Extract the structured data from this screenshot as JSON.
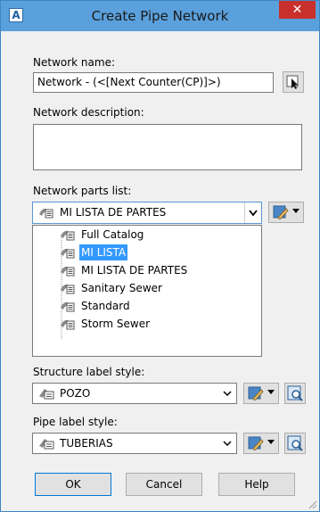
{
  "window": {
    "title": "Create Pipe Network",
    "app_icon_letter": "A",
    "close_glyph": "✕"
  },
  "network_name": {
    "label": "Network name:",
    "value": "Network - (<[Next Counter(CP)]>)"
  },
  "network_description": {
    "label": "Network description:",
    "value": ""
  },
  "parts_list": {
    "label": "Network parts list:",
    "selected": "MI LISTA DE PARTES",
    "items": [
      "Full Catalog",
      "MI LISTA",
      "MI LISTA DE PARTES",
      "Sanitary Sewer",
      "Standard",
      "Storm Sewer"
    ],
    "highlighted_index": 1
  },
  "structure_label_style": {
    "label": "Structure label style:",
    "value": "POZO"
  },
  "pipe_label_style": {
    "label": "Pipe label style:",
    "value": "TUBERIAS"
  },
  "buttons": {
    "ok": "OK",
    "cancel": "Cancel",
    "help": "Help"
  },
  "colors": {
    "titlebar": "#5aa0dc",
    "selection": "#3399ff",
    "close": "#c9302c"
  }
}
